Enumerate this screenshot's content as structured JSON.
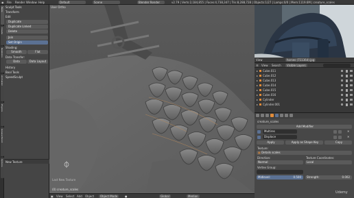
{
  "topbar": {
    "menu": [
      "File",
      "Render",
      "Window",
      "Help"
    ],
    "layout": "Default",
    "scene": "Scene",
    "engine": "Blender Render",
    "stats": "v2.79 | Verts:2,184,855 | Faces:4,738,347 | Tris:8,288,728 | Objects:1/27 | Lamps:0/0 | Mem:1119.6M | creature_scales"
  },
  "left_tabs": [
    "Tools",
    "Create",
    "Relations",
    "Animation",
    "Physics",
    "Grease Pencil",
    "Options"
  ],
  "tools_panel": {
    "sculpt_tools": "Sculpt Tools",
    "transform": "Transform",
    "edit": "Edit",
    "duplicate": "Duplicate",
    "duplicate_linked": "Duplicate Linked",
    "delete": "Delete",
    "join": "Join",
    "set_origin": "Set Origin",
    "shading": "Shading:",
    "smooth": "Smooth",
    "flat": "Flat",
    "data_transfer": "Data Transfer:",
    "data": "Data",
    "data_layout": "Data Layout",
    "history": "History",
    "bool_tools": "Bool Tools",
    "speed_sculpt": "SpeedSculpt",
    "new_texture": "New Texture"
  },
  "viewport": {
    "view_label": "User Ortho",
    "object_label": "(0) creature_scales",
    "footer_hint": "Last New Texture"
  },
  "viewport_header": {
    "items": [
      "View",
      "Select",
      "Add",
      "Object"
    ],
    "mode": "Object Mode",
    "orientation": "Global",
    "pivot": "Median"
  },
  "outliner": {
    "menu": [
      "View",
      "Search"
    ],
    "search_placeholder": "Search",
    "filter": "Visible Layers",
    "items": [
      "Cube.011",
      "Cube.012",
      "Cube.013",
      "Cube.014",
      "Cube.015",
      "Cube.016",
      "Cylinder",
      "Cylinder.001"
    ],
    "header_items": [
      "View",
      "Search"
    ],
    "photo_tab": "horses (711364).jpg"
  },
  "properties": {
    "breadcrumb": "creature_scales",
    "add_modifier": "Add Modifier",
    "multires_label": "Multires",
    "displace_label": "Displace",
    "apply": "Apply",
    "apply_shape": "Apply as Shape Key",
    "copy": "Copy",
    "texture_label": "Texture:",
    "texture_name": "Details scales",
    "direction_label": "Direction:",
    "direction_value": "Normal",
    "texcoord_label": "Texture Coordinates:",
    "texcoord_value": "Local",
    "vgroup_label": "Vertex Group:",
    "midlevel_label": "Midlevel:",
    "midlevel_value": "0.500",
    "strength_label": "Strength:",
    "strength_value": "0.002"
  },
  "colors": {
    "accent": "#5b7193",
    "active_orange": "#e08b3a",
    "panel": "#474747"
  },
  "watermark": "Udemy"
}
